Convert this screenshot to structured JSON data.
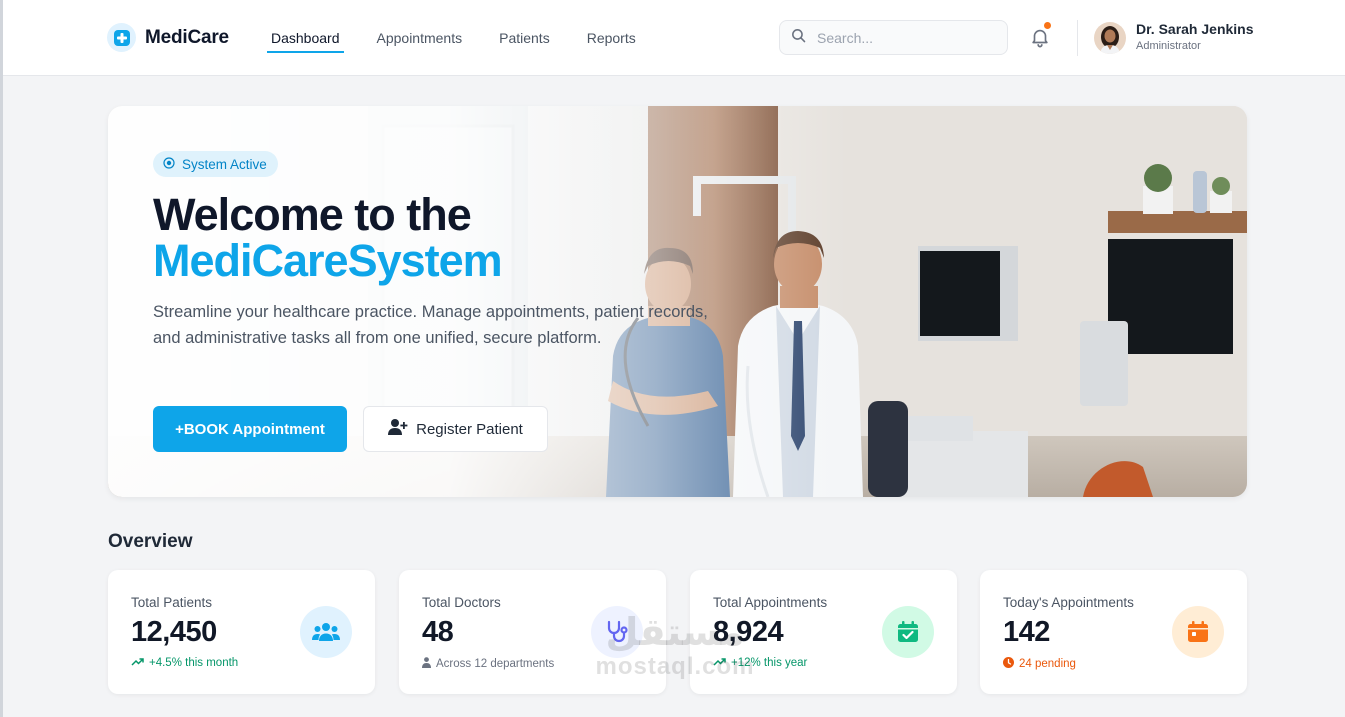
{
  "header": {
    "brand": "MediCare",
    "nav": [
      {
        "label": "Dashboard",
        "active": true
      },
      {
        "label": "Appointments",
        "active": false
      },
      {
        "label": "Patients",
        "active": false
      },
      {
        "label": "Reports",
        "active": false
      }
    ],
    "search": {
      "placeholder": "Search...",
      "value": ""
    },
    "user": {
      "name": "Dr. Sarah Jenkins",
      "role": "Administrator"
    },
    "icons": [
      "medical-plus-icon",
      "search-icon",
      "bell-icon"
    ],
    "notification_dot_color": "#f97316"
  },
  "hero": {
    "badge": "System Active",
    "title_line1": "Welcome to the",
    "title_line2": "MediCareSystem",
    "description": "Streamline your healthcare practice. Manage appointments, patient records, and administrative tasks all from one unified, secure platform.",
    "primary_button": "+BOOK Appointment",
    "secondary_button": "Register Patient",
    "accent_color": "#0ea5e9"
  },
  "overview": {
    "title": "Overview",
    "stats": [
      {
        "label": "Total Patients",
        "value": "12,450",
        "note": "+4.5% this month",
        "note_icon": "trend-up-icon",
        "icon": "users-icon",
        "color": "#0ea5e9"
      },
      {
        "label": "Total Doctors",
        "value": "48",
        "note": "Across 12 departments",
        "note_icon": "doctor-icon",
        "icon": "stethoscope-icon",
        "color": "#6366f1"
      },
      {
        "label": "Total Appointments",
        "value": "8,924",
        "note": "+12% this year",
        "note_icon": "trend-up-icon",
        "icon": "calendar-check-icon",
        "color": "#10b981"
      },
      {
        "label": "Today's Appointments",
        "value": "142",
        "note": "24 pending",
        "note_icon": "clock-icon",
        "icon": "calendar-icon",
        "color": "#f97316"
      }
    ]
  },
  "watermark": {
    "arabic": "مستقل",
    "latin": "mostaql.com"
  }
}
